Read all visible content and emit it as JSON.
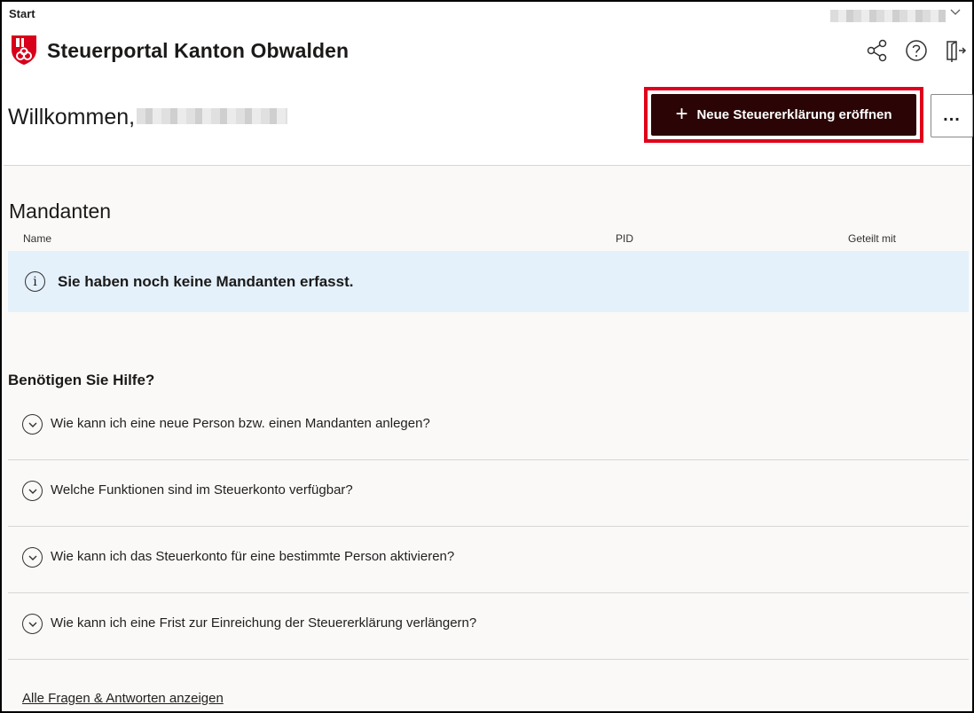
{
  "breadcrumb": "Start",
  "app": {
    "title": "Steuerportal Kanton Obwalden"
  },
  "header_icons": [
    "share-icon",
    "help-icon",
    "logout-icon"
  ],
  "welcome": {
    "greeting": "Willkommen,"
  },
  "actions": {
    "new_return_label": "Neue Steuererklärung eröffnen",
    "more_label": "..."
  },
  "mandanten": {
    "title": "Mandanten",
    "columns": [
      "Name",
      "PID",
      "Geteilt mit"
    ],
    "empty_message": "Sie haben noch keine Mandanten erfasst."
  },
  "help": {
    "title": "Benötigen Sie Hilfe?",
    "faqs": [
      "Wie kann ich eine neue Person bzw. einen Mandanten anlegen?",
      "Welche Funktionen sind im Steuerkonto verfügbar?",
      "Wie kann ich das Steuerkonto für eine bestimmte Person aktivieren?",
      "Wie kann ich eine Frist zur Einreichung der Steuererklärung verlängern?"
    ],
    "all_link": "Alle Fragen & Antworten anzeigen"
  },
  "colors": {
    "primary": "#2b0505",
    "highlight": "#e0001b",
    "info_bg": "#e4f1fb"
  }
}
